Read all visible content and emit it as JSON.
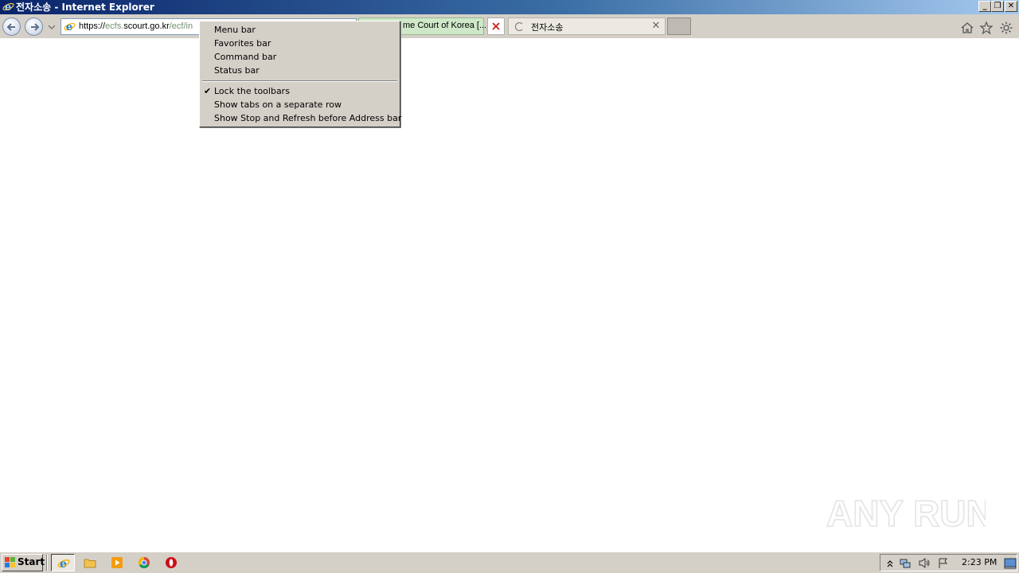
{
  "window": {
    "title": "전자소송 - Internet Explorer",
    "controls": {
      "minimize": "_",
      "restore": "❐",
      "close": "✕"
    }
  },
  "address_bar": {
    "url_proto": "https://",
    "url_pre": "ecfs.",
    "url_domain": "scourt.go.kr",
    "url_path": "/ecf/in"
  },
  "tabs": [
    {
      "label": "me Court of Korea [...",
      "state": "active"
    },
    {
      "label": "전자소송",
      "state": "loading",
      "close": "✕"
    }
  ],
  "context_menu": {
    "items": [
      {
        "label": "Menu bar",
        "checked": false
      },
      {
        "label": "Favorites bar",
        "checked": false
      },
      {
        "label": "Command bar",
        "checked": false
      },
      {
        "label": "Status bar",
        "checked": false
      },
      {
        "label": "Lock the toolbars",
        "checked": true
      },
      {
        "label": "Show tabs on a separate row",
        "checked": false
      },
      {
        "label": "Show Stop and Refresh before Address bar",
        "checked": false
      }
    ],
    "check_glyph": "✔"
  },
  "watermark": {
    "text": "ANY RUN"
  },
  "taskbar": {
    "start_label": "Start",
    "apps": [
      "internet-explorer",
      "file-explorer",
      "media-player",
      "chrome",
      "opera"
    ],
    "clock": "2:23 PM"
  },
  "colors": {
    "titlebar_start": "#0a246a",
    "chrome_gray": "#d4d0c8",
    "tab_green": "#cfe8c8"
  }
}
